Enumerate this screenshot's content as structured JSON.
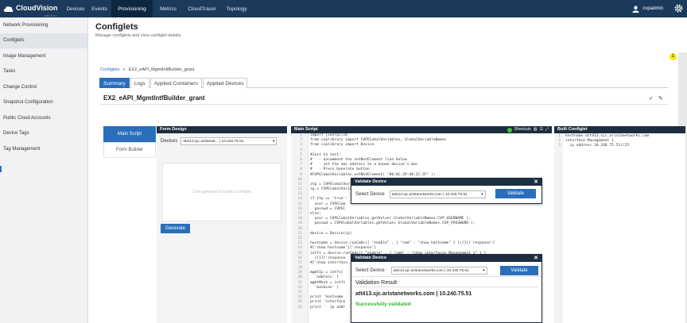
{
  "brand": {
    "name": "CloudVision",
    "sub": "ARISTA"
  },
  "topnav": [
    {
      "label": "Devices",
      "w": 30
    },
    {
      "label": "Events",
      "w": 30
    },
    {
      "label": "Provisioning",
      "w": 52,
      "active": true
    },
    {
      "label": "Metrics",
      "w": 39
    },
    {
      "label": "CloudTracer",
      "w": 46
    },
    {
      "label": "Topology",
      "w": 41
    }
  ],
  "user": {
    "name": "cvpadmin"
  },
  "sidebar": [
    {
      "label": "Network Provisioning"
    },
    {
      "label": "Configlets",
      "active": true
    },
    {
      "label": "Image Management"
    },
    {
      "label": "Tasks"
    },
    {
      "label": "Change Control"
    },
    {
      "label": "Snapshot Configuration"
    },
    {
      "label": "Public Cloud Accounts"
    },
    {
      "label": "Device Tags"
    },
    {
      "label": "Tag Management"
    }
  ],
  "page": {
    "title": "Configlets",
    "subtitle": "Manage configlets and view configlet details.",
    "notification_count": "1"
  },
  "breadcrumb": {
    "root": "Configlets",
    "sep": ">",
    "current": "EX2_eAPI_MgmtIntfBuilder_grant"
  },
  "tabs": [
    {
      "label": "Summary",
      "active": true
    },
    {
      "label": "Logs"
    },
    {
      "label": "Applied Containers"
    },
    {
      "label": "Applied Devices"
    }
  ],
  "configlet": {
    "title": "EX2_eAPI_MgmtIntfBuilder_grant",
    "action_check": "✓",
    "action_edit": "✎"
  },
  "left_nav": [
    {
      "label": "Main Script",
      "active": true
    },
    {
      "label": "Form Builder"
    }
  ],
  "form_design": {
    "header": "Form Design",
    "device_label": "Devices",
    "device_value": "att413.sjc.aristanet...  | 10.240.75.51",
    "placeholder": "Click generate to build a configlet",
    "generate": "Generate"
  },
  "main_script": {
    "header": "Main Script",
    "shortcuts": "Shortcuts",
    "lines": [
      {
        "n": "1",
        "t": "import jsonrpclib"
      },
      {
        "n": "2",
        "t": "from cvplibrary import CVPGlobalVariables, GlobalVariableNames"
      },
      {
        "n": "3",
        "t": "from cvplibrary import Device"
      },
      {
        "n": "4",
        "t": ""
      },
      {
        "n": "5",
        "t": "#Just to test:"
      },
      {
        "n": "6",
        "t": "#   - uncomment the setNetElement line below"
      },
      {
        "n": "7",
        "t": "#   - set the mac address to a known device's mac"
      },
      {
        "n": "8",
        "t": "#   - Press Generate button"
      },
      {
        "n": "9",
        "t": "#CVPGlobalVariables.setNetElement( \"00:0C:29:40:2C:2F\" );"
      },
      {
        "n": "10",
        "t": ""
      },
      {
        "n": "11",
        "t": "ztp = CVPGlobalVariables.getValue( GlobalVariableNames.ZTP_STATE );"
      },
      {
        "n": "12",
        "t": "ip = CVPGlobalVariables.getValue( GlobalVariableNames.CVP_IP );"
      },
      {
        "n": "13",
        "t": ""
      },
      {
        "n": "14",
        "t": "if ztp == 'true':"
      },
      {
        "n": "15",
        "t": "  user = CVPGlob"
      },
      {
        "n": "16",
        "t": "  passwd = CVPGl"
      },
      {
        "n": "17",
        "t": "else:"
      },
      {
        "n": "18",
        "t": "  user = CVPGlobalVariables.getValue( GlobalVariableNames.CVP_USERNAME );"
      },
      {
        "n": "19",
        "t": "  passwd = CVPGlobalVariables.getValue( GlobalVariableNames.CVP_PASSWORD );"
      },
      {
        "n": "20",
        "t": ""
      },
      {
        "n": "21",
        "t": "device = Device(ip)"
      },
      {
        "n": "22",
        "t": ""
      },
      {
        "n": "23",
        "t": "hostname = device.runCmds([ \"enable\" , { \"cmd\" : \"show hostname\" } ])[1]['response']"
      },
      {
        "n": "24",
        "t": "#['show hostname']['response']"
      },
      {
        "n": "25",
        "t": "intfs = device.runCmds([ \"enable\" , { \"cmd\" : \"show interfaces Management 1\" } ]"
      },
      {
        "n": "26",
        "t": "  )[1]['response"
      },
      {
        "n": "27",
        "t": "#['show interface"
      },
      {
        "n": "28",
        "t": ""
      },
      {
        "n": "29",
        "t": "mgmtIp = intfs["
      },
      {
        "n": "30",
        "t": "  'address' ]"
      },
      {
        "n": "31",
        "t": "mgmtMask = intfs"
      },
      {
        "n": "32",
        "t": "  'maskLen' ]"
      },
      {
        "n": "33",
        "t": ""
      },
      {
        "n": "34",
        "t": "print 'hostname"
      },
      {
        "n": "35",
        "t": "print 'interface"
      },
      {
        "n": "36",
        "t": "print '  ip addr"
      }
    ]
  },
  "built_configlet": {
    "header": "Built Configlet",
    "lines": [
      {
        "n": "1",
        "t": "hostname att413.sjc.aristanetworks.com"
      },
      {
        "n": "2",
        "t": "interface Management 1"
      },
      {
        "n": "3",
        "t": "  ip address 10.240.75.51//25"
      }
    ]
  },
  "modal1": {
    "title": "Validate Device",
    "close": "✕",
    "label": "Select Device",
    "device": "att413.sjc.aristanetworks.com  | 10.240.75.51",
    "button": "Validate"
  },
  "modal2": {
    "title": "Validate Device",
    "close": "✕",
    "label": "Select Device",
    "device": "att413.sjc.aristanetworks.com  | 10.240.75.51",
    "button": "Validate",
    "result_title": "Validation Result",
    "result_device": "att413.sjc.aristanetworks.com  | 10.240.75.51",
    "result_status": "Successfully validated"
  }
}
